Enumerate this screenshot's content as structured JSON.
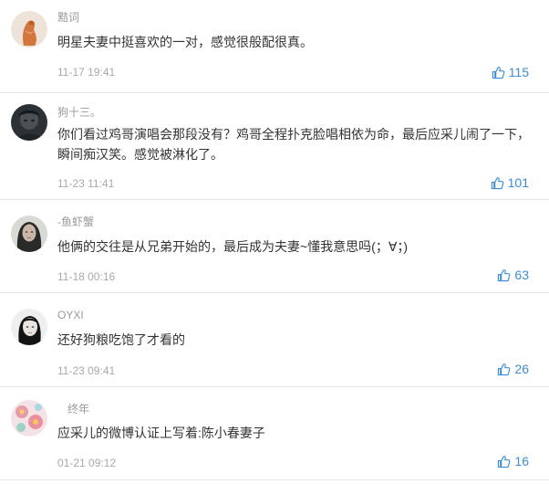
{
  "accent_color": "#3d8cd7",
  "comments": [
    {
      "username": "黠词",
      "avatar": "avatar-orange-figure-icon",
      "text": "明星夫妻中挺喜欢的一对，感觉很般配很真。",
      "time": "11-17 19:41",
      "likes": "115"
    },
    {
      "username": "狗十三。",
      "avatar": "avatar-dark-portrait-icon",
      "text": "你们看过鸡哥演唱会那段没有？鸡哥全程扑克脸唱相依为命，最后应采儿闹了一下，瞬间痴汉笑。感觉被淋化了。",
      "time": "11-23 11:41",
      "likes": "101"
    },
    {
      "username": "-鱼虾蟹",
      "avatar": "avatar-woman-portrait-icon",
      "text": "他俩的交往是从兄弟开始的，最后成为夫妻~懂我意思吗(；∀；)",
      "time": "11-18 00:16",
      "likes": "63"
    },
    {
      "username": "OYXI",
      "avatar": "avatar-bw-portrait-icon",
      "text": "还好狗粮吃饱了才看的",
      "time": "11-23 09:41",
      "likes": "26"
    },
    {
      "username": "终年",
      "avatar": "avatar-pink-flowers-icon",
      "text": "应采儿的微博认证上写着:陈小春妻子",
      "time": "01-21 09:12",
      "likes": "16"
    }
  ]
}
